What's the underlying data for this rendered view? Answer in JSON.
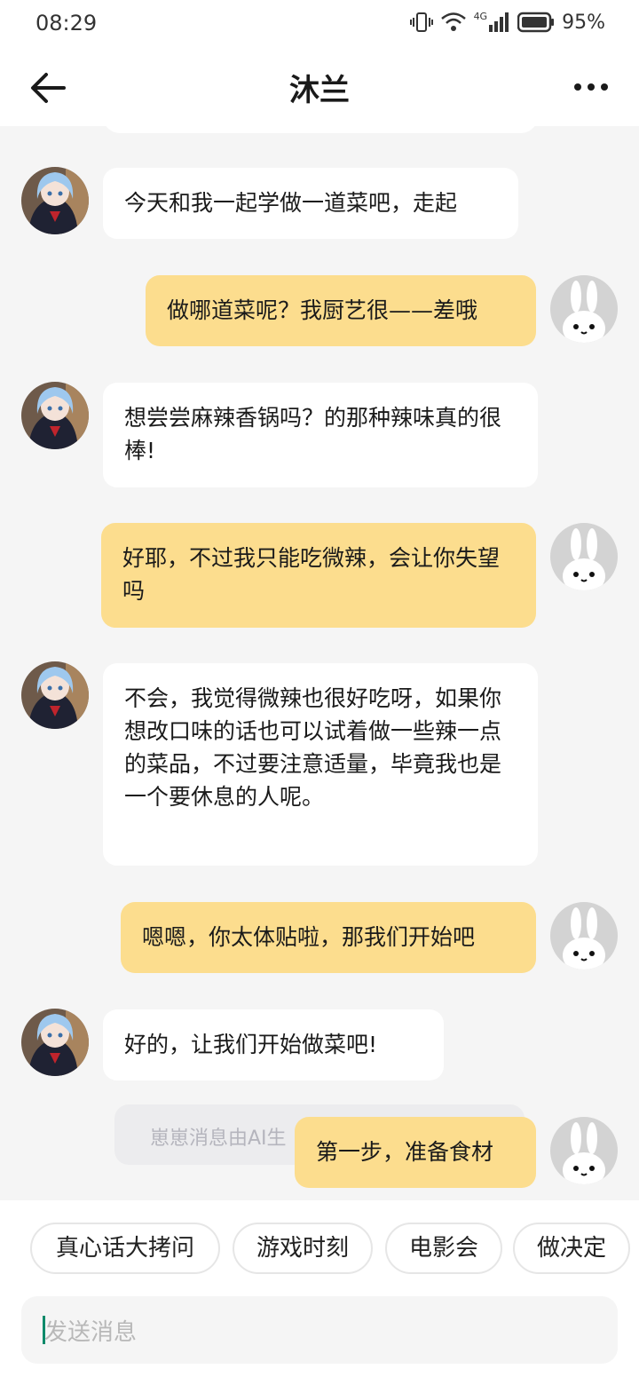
{
  "status": {
    "time": "08:29",
    "battery": "95%",
    "network": "4G"
  },
  "nav": {
    "title": "沐兰",
    "back_icon": "arrow-left-icon",
    "more_icon": "more-dots-icon"
  },
  "messages": [
    {
      "side": "left",
      "text": "今天和我一起学做一道菜吧，走起"
    },
    {
      "side": "right",
      "text": "做哪道菜呢？我厨艺很——差哦"
    },
    {
      "side": "left",
      "text": "想尝尝麻辣香锅吗？的那种辣味真的很棒!"
    },
    {
      "side": "right",
      "text": "好耶，不过我只能吃微辣，会让你失望吗"
    },
    {
      "side": "left",
      "text": "不会，我觉得微辣也很好吃呀，如果你想改口味的话也可以试着做一些辣一点的菜品，不过要注意适量，毕竟我也是一个要休息的人呢。"
    },
    {
      "side": "right",
      "text": "嗯嗯，你太体贴啦，那我们开始吧"
    },
    {
      "side": "left",
      "text": "好的，让我们开始做菜吧!"
    },
    {
      "side": "right",
      "text": "第一步，准备食材"
    }
  ],
  "ai_notice": "崽崽消息由AI生",
  "quick_replies": [
    "真心话大拷问",
    "游戏时刻",
    "电影会",
    "做决定"
  ],
  "input": {
    "placeholder": "发送消息"
  },
  "colors": {
    "user_bubble": "#fcdd8e",
    "bot_bubble": "#ffffff",
    "background": "#f5f5f5"
  }
}
